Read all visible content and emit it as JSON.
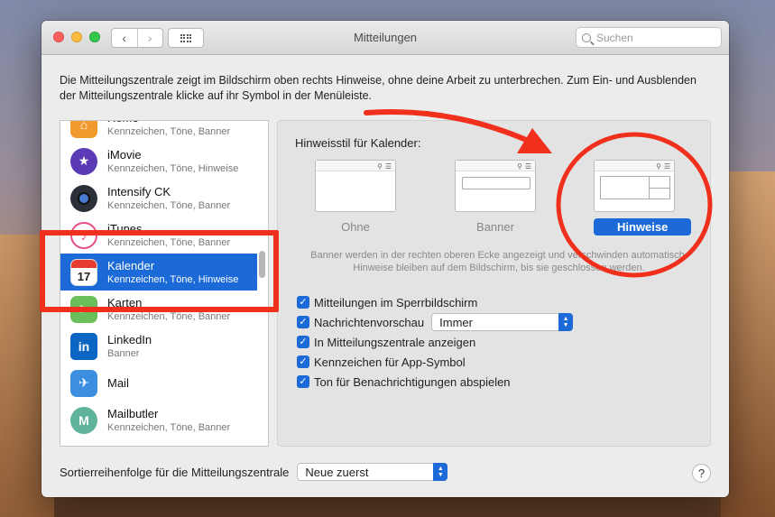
{
  "window": {
    "title": "Mitteilungen",
    "search_placeholder": "Suchen"
  },
  "intro_text": "Die Mitteilungszentrale zeigt im Bildschirm oben rechts Hinweise, ohne deine Arbeit zu unterbrechen. Zum Ein- und Ausblenden der Mitteilungszentrale klicke auf ihr Symbol in der Menüleiste.",
  "apps": [
    {
      "name": "Home",
      "sub": "Kennzeichen, Töne, Banner",
      "icon": "home-icon",
      "color": "#f19a2d"
    },
    {
      "name": "iMovie",
      "sub": "Kennzeichen, Töne, Hinweise",
      "icon": "imovie-icon",
      "color": "#5b3bb5"
    },
    {
      "name": "Intensify CK",
      "sub": "Kennzeichen, Töne, Banner",
      "icon": "intensify-icon",
      "color": "#2a2f3a"
    },
    {
      "name": "iTunes",
      "sub": "Kennzeichen, Töne, Banner",
      "icon": "itunes-icon",
      "color": "#e84c8a"
    },
    {
      "name": "Kalender",
      "sub": "Kennzeichen, Töne, Hinweise",
      "icon": "calendar-icon",
      "color": "#ffffff",
      "selected": true
    },
    {
      "name": "Karten",
      "sub": "Kennzeichen, Töne, Banner",
      "icon": "maps-icon",
      "color": "#6bbf5b"
    },
    {
      "name": "LinkedIn",
      "sub": "Banner",
      "icon": "linkedin-icon",
      "color": "#0a66c2"
    },
    {
      "name": "Mail",
      "sub": "",
      "icon": "mail-icon",
      "color": "#3c8fe0"
    },
    {
      "name": "Mailbutler",
      "sub": "Kennzeichen, Töne, Banner",
      "icon": "mailbutler-icon",
      "color": "#5fb39b"
    }
  ],
  "style": {
    "label": "Hinweisstil für Kalender:",
    "options": [
      "Ohne",
      "Banner",
      "Hinweise"
    ],
    "selected": "Hinweise",
    "description": "Banner werden in der rechten oberen Ecke angezeigt und verschwinden automatisch. Hinweise bleiben auf dem Bildschirm, bis sie geschlossen werden."
  },
  "checks": [
    {
      "label": "Mitteilungen im Sperrbildschirm",
      "checked": true
    },
    {
      "label": "Nachrichtenvorschau",
      "checked": true
    },
    {
      "label": "In Mitteilungszentrale anzeigen",
      "checked": true
    },
    {
      "label": "Kennzeichen für App-Symbol",
      "checked": true
    },
    {
      "label": "Ton für Benachrichtigungen abspielen",
      "checked": true
    }
  ],
  "preview_popup": "Immer",
  "sort": {
    "label": "Sortierreihenfolge für die Mitteilungszentrale",
    "value": "Neue zuerst"
  },
  "help_label": "?",
  "colors": {
    "accent": "#1b6ad8",
    "annotation": "#f0301c"
  }
}
